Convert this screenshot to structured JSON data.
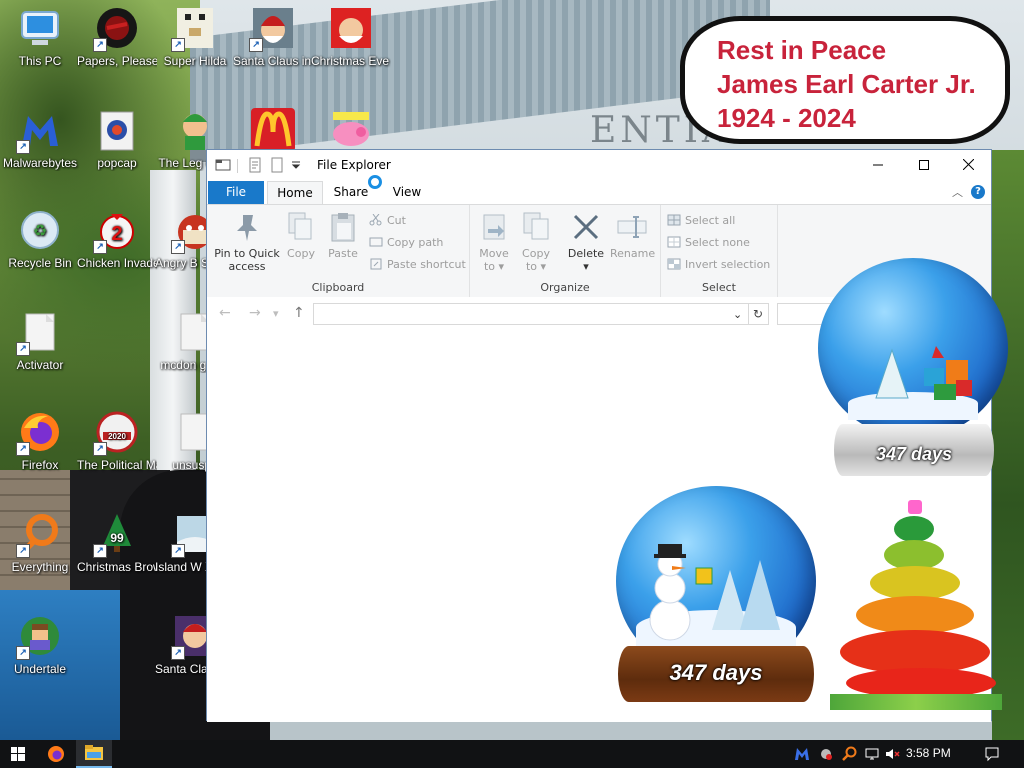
{
  "bubble": {
    "line1": "Rest in Peace",
    "line2": "James Earl Carter Jr.",
    "line3": "1924 - 2024"
  },
  "wallpaper": {
    "building_text": "ENTIAL"
  },
  "desktop_icons": [
    {
      "label": "This PC",
      "icon": "this-pc-icon"
    },
    {
      "label": "Papers, Please",
      "icon": "papers-please-icon"
    },
    {
      "label": "Super Hilda",
      "icon": "super-hilda-icon"
    },
    {
      "label": "Santa Claus in Trouble... A...",
      "icon": "santa-claus-icon"
    },
    {
      "label": "Christmas Eve Crisis",
      "icon": "christmas-eve-crisis-icon"
    },
    {
      "label": "Malwarebytes",
      "icon": "malwarebytes-icon"
    },
    {
      "label": "popcap",
      "icon": "popcap-icon"
    },
    {
      "label": "The Leg of Zil",
      "icon": "legend-of-zelda-icon"
    },
    {
      "label": "Recycle Bin",
      "icon": "recycle-bin-icon"
    },
    {
      "label": "Chicken Invaders 2",
      "icon": "chicken-invaders-icon"
    },
    {
      "label": "Angry B Seaso",
      "icon": "angry-birds-icon"
    },
    {
      "label": "Activator",
      "icon": "activator-icon"
    },
    {
      "label": "mcdon game",
      "icon": "mcdonalds-game-icon"
    },
    {
      "label": "Firefox",
      "icon": "firefox-icon"
    },
    {
      "label": "The Political Machine 2...",
      "icon": "political-machine-icon"
    },
    {
      "label": "unsuspe",
      "icon": "unsuspected-icon"
    },
    {
      "label": "Everything",
      "icon": "everything-icon"
    },
    {
      "label": "Christmas Browser 99",
      "icon": "christmas-browser-icon"
    },
    {
      "label": "Island W Xmas",
      "icon": "island-xmas-icon"
    },
    {
      "label": "Undertale",
      "icon": "undertale-icon"
    },
    {
      "label": "Santa Cla Troub",
      "icon": "santa-trouble-icon"
    }
  ],
  "explorer": {
    "title": "File Explorer",
    "tabs": {
      "file": "File",
      "home": "Home",
      "share": "Share",
      "view": "View"
    },
    "ribbon": {
      "clipboard": {
        "group_label": "Clipboard",
        "pin_line1": "Pin to Quick",
        "pin_line2": "access",
        "copy": "Copy",
        "paste": "Paste",
        "cut": "Cut",
        "copy_path": "Copy path",
        "paste_shortcut": "Paste shortcut"
      },
      "organize": {
        "group_label": "Organize",
        "move_line1": "Move",
        "move_line2": "to",
        "copy_line1": "Copy",
        "copy_line2": "to",
        "delete": "Delete",
        "rename": "Rename"
      },
      "select": {
        "group_label": "Select",
        "select_all": "Select all",
        "select_none": "Select none",
        "invert": "Invert selection"
      }
    },
    "address": {
      "value": "",
      "search_placeholder": ""
    }
  },
  "decorations": {
    "globe_top_days": "347 days",
    "globe_bottom_days": "347 days"
  },
  "taskbar": {
    "time": "3:58 PM"
  },
  "colors": {
    "accent": "#1979ca",
    "bubble_text": "#c8233b",
    "taskbar": "#111214"
  }
}
